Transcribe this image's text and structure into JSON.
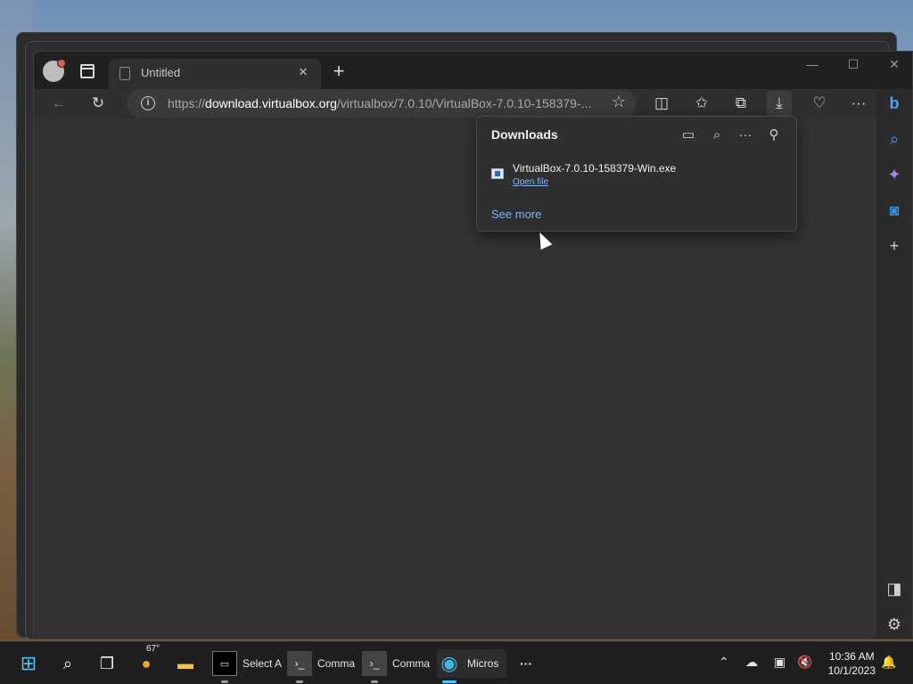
{
  "browser": {
    "tab_title": "Untitled",
    "tab_close": "×",
    "new_tab": "+",
    "window_controls": {
      "minimize": "—",
      "maximize": "☐",
      "close": "✕"
    },
    "url_prefix": "https://",
    "url_host": "download.virtualbox.org",
    "url_path": "/virtualbox/7.0.10/VirtualBox-7.0.10-158379-...",
    "toolbar_icons": [
      "back-icon",
      "refresh-icon",
      "info-icon",
      "favorite-star-icon",
      "split-screen-icon",
      "favorites-icon",
      "collections-icon",
      "downloads-icon",
      "browser-essentials-icon",
      "more-icon"
    ],
    "sidebar_icons": [
      "bing-copilot-icon",
      "search-icon",
      "copilot-icon",
      "outlook-icon",
      "add-icon",
      "sidebar-toggle-icon",
      "settings-icon"
    ]
  },
  "downloads": {
    "title": "Downloads",
    "items": [
      {
        "file_name": "VirtualBox-7.0.10-158379-Win.exe",
        "action": "Open file"
      }
    ],
    "see_more": "See more"
  },
  "taskbar": {
    "apps": [
      {
        "label": ""
      },
      {
        "label": ""
      },
      {
        "label": ""
      },
      {
        "label": "",
        "badge": "67°"
      },
      {
        "label": ""
      },
      {
        "label": "Select A"
      },
      {
        "label": "Comma"
      },
      {
        "label": "Comma"
      },
      {
        "label": "Micros"
      },
      {
        "label": "···"
      }
    ],
    "clock_time": "10:36 AM",
    "clock_date": "10/1/2023"
  },
  "colors": {
    "accent": "#4cc2ff",
    "link": "#7fb4f5",
    "background": "#333333"
  }
}
